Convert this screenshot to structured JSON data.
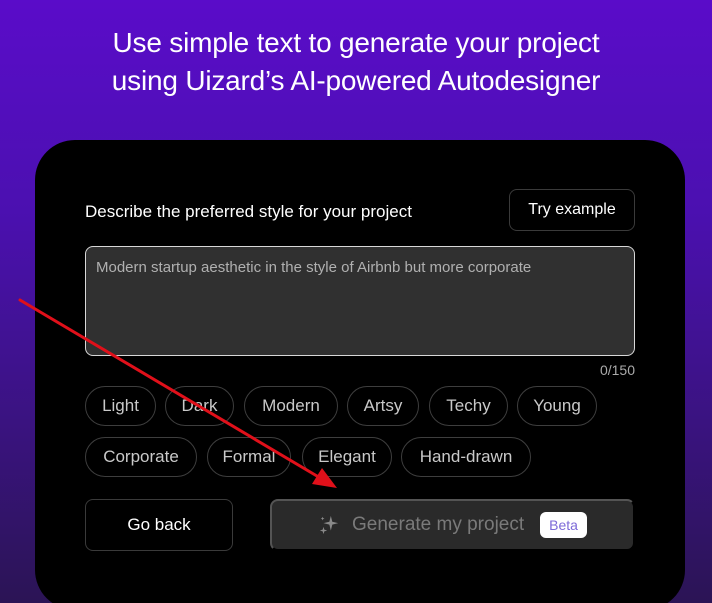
{
  "hero": {
    "line1": "Use simple text to generate your project",
    "line2": "using Uizard’s AI-powered Autodesigner"
  },
  "form": {
    "prompt_label": "Describe the preferred style for your project",
    "try_example_label": "Try example",
    "textarea_placeholder": "Modern startup aesthetic in the style of Airbnb but more corporate",
    "textarea_value": "",
    "counter": "0/150",
    "chips": [
      "Light",
      "Dark",
      "Modern",
      "Artsy",
      "Techy",
      "Young",
      "Corporate",
      "Formal",
      "Elegant",
      "Hand-drawn"
    ]
  },
  "actions": {
    "go_back_label": "Go back",
    "generate_label": "Generate my project",
    "beta_badge": "Beta"
  },
  "icons": {
    "generate": "sparkle-icon"
  },
  "colors": {
    "background_top": "#5a0cc9",
    "background_bottom": "#2b1455",
    "card": "#000000",
    "annotation_arrow": "#e0101a",
    "beta_text": "#7d6ad8"
  }
}
